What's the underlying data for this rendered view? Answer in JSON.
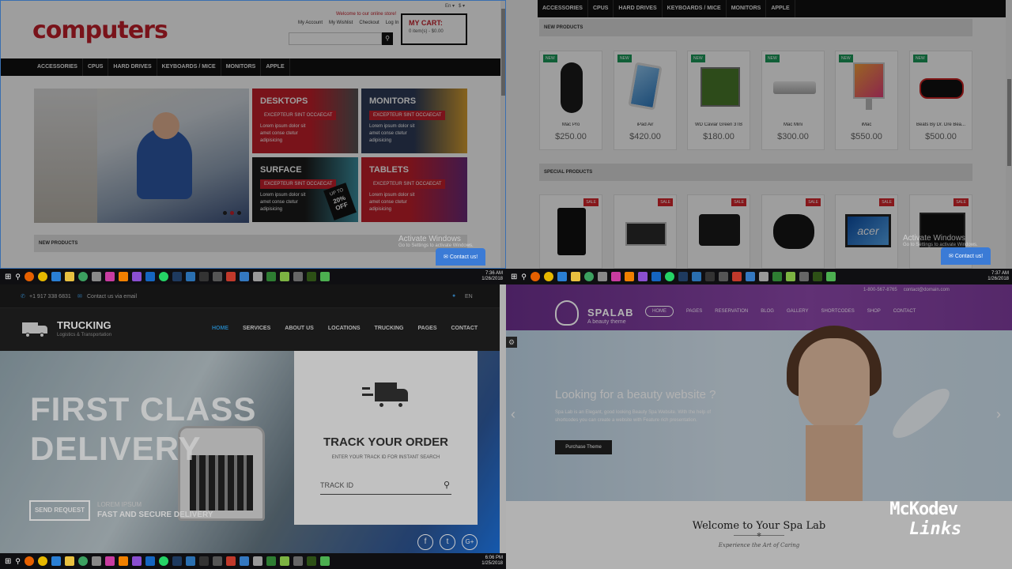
{
  "q1": {
    "logo": "computers",
    "welcome": "Welcome to our online store!",
    "lang": "En",
    "currency": "$",
    "account_links": [
      "My Account",
      "My Wishlist",
      "Checkout",
      "Log In"
    ],
    "cart_title": "MY CART:",
    "cart_value": "0 item(s) - $0.00",
    "nav": [
      "ACCESSORIES",
      "CPUS",
      "HARD DRIVES",
      "KEYBOARDS / MICE",
      "MONITORS",
      "APPLE"
    ],
    "tiles": [
      {
        "title": "DESKTOPS",
        "tag": "EXCEPTEUR SINT OCCAECAT",
        "text": "Lorem ipsum dolor sit amet conse ctetur adipisicing"
      },
      {
        "title": "MONITORS",
        "tag": "EXCEPTEUR SINT OCCAECAT",
        "text": "Lorem ipsum dolor sit amet conse ctetur adipisicing"
      },
      {
        "title": "SURFACE",
        "tag": "EXCEPTEUR SINT OCCAECAT",
        "text": "Lorem ipsum dolor sit amet conse ctetur adipisicing"
      },
      {
        "title": "TABLETS",
        "tag": "EXCEPTEUR SINT OCCAECAT",
        "text": "Lorem ipsum dolor sit amet conse ctetur adipisicing"
      }
    ],
    "upto": "UP TO",
    "off": "20% OFF",
    "new_products": "NEW PRODUCTS",
    "activate": "Activate Windows",
    "activate_sub": "Go to Settings to activate Windows.",
    "contact": "Contact us!",
    "time": "7:36 AM",
    "date": "1/26/2018"
  },
  "q2": {
    "nav": [
      "ACCESSORIES",
      "CPUS",
      "HARD DRIVES",
      "KEYBOARDS / MICE",
      "MONITORS",
      "APPLE"
    ],
    "new_products": "NEW PRODUCTS",
    "new_badge": "NEW",
    "products": [
      {
        "name": "Mac Pro",
        "price": "$250.00"
      },
      {
        "name": "iPad Air",
        "price": "$420.00"
      },
      {
        "name": "WD Caviar Green 3TB",
        "price": "$180.00"
      },
      {
        "name": "Mac Mini",
        "price": "$300.00"
      },
      {
        "name": "iMac",
        "price": "$550.00"
      },
      {
        "name": "Beats By Dr. Dre Bea...",
        "price": "$500.00"
      }
    ],
    "special_products": "SPECIAL PRODUCTS",
    "sale_badge": "SALE",
    "acer_logo": "acer",
    "activate": "Activate Windows",
    "activate_sub": "Go to Settings to activate Windows.",
    "contact": "Contact us!",
    "time": "7:37 AM",
    "date": "1/26/2018"
  },
  "q3": {
    "phone": "+1 917 338 6831",
    "email_link": "Contact us via email",
    "lang": "EN",
    "brand": "TRUCKING",
    "brand_sub": "Logistics & Transportation",
    "nav": [
      "HOME",
      "SERVICES",
      "ABOUT US",
      "LOCATIONS",
      "TRUCKING",
      "PAGES",
      "CONTACT"
    ],
    "hero_line1": "FIRST CLASS",
    "hero_line2": "DELIVERY",
    "send_request": "SEND REQUEST",
    "lorem": "LOREM IPSUM",
    "tagline": "FAST AND SECURE DELIVERY",
    "track_title": "TRACK YOUR ORDER",
    "track_sub": "ENTER YOUR TRACK ID FOR INSTANT SEARCH",
    "track_placeholder": "TRACK ID",
    "time": "6:06 PM",
    "date": "1/25/2018"
  },
  "q4": {
    "top_phone": "1-800-567-8765",
    "top_email": "contact@domain.com",
    "brand": "SPALAB",
    "brand_sub": "A beauty theme",
    "nav": [
      "HOME",
      "PAGES",
      "RESERVATION",
      "BLOG",
      "GALLERY",
      "SHORTCODES",
      "SHOP",
      "CONTACT"
    ],
    "hero_title": "Looking for a beauty website ?",
    "hero_text": "Spa Lab is an Elegant, good looking Beauty Spa Website. With the help of shortcodes you can create a website with Feature rich presentation.",
    "cta": "Purchase Theme",
    "welcome": "Welcome to Your Spa Lab",
    "subtitle": "Experience the Art of Caring",
    "watermark_top": "McKodev",
    "watermark_bottom": "Links"
  }
}
